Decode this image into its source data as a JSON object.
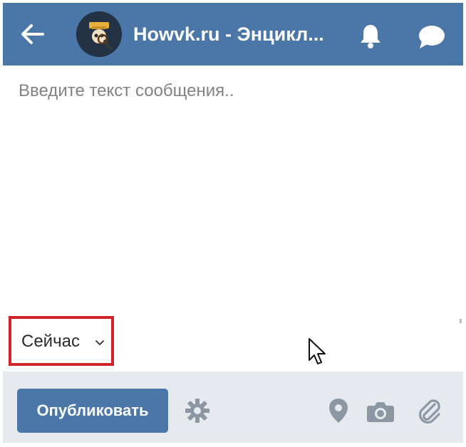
{
  "colors": {
    "accent": "#4a76a8",
    "header_icon": "#ffffff",
    "toolbar_icon": "#8d97a3",
    "highlight_border": "#d0242b",
    "bottom_bar": "#e6e9ee"
  },
  "header": {
    "back_icon": "arrow-left-icon",
    "avatar_icon": "community-avatar",
    "title": "Howvk.ru - Энцикл...",
    "bell_icon": "bell-icon",
    "chat_icon": "chat-bubble-icon"
  },
  "compose": {
    "placeholder": "Введите текст сообщения..",
    "value": "",
    "schedule": {
      "label": "Сейчас",
      "chevron_icon": "chevron-down-icon"
    }
  },
  "toolbar": {
    "publish_label": "Опубликовать",
    "settings_icon": "gear-icon",
    "place_icon": "location-pin-icon",
    "camera_icon": "camera-icon",
    "attach_icon": "paperclip-icon"
  }
}
